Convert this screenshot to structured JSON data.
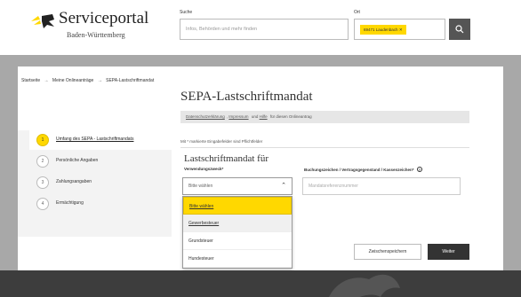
{
  "header": {
    "logo_title": "Serviceportal",
    "logo_sub": "Baden-Württemberg",
    "search_label": "Suche",
    "search_placeholder": "Infos, Behörden und mehr finden",
    "ort_label": "Ort",
    "ort_value": "69471 Laudenbach",
    "search_button_icon": "search-icon"
  },
  "breadcrumb": [
    "Startseite",
    "→",
    "Meine Onlineanträge",
    "→",
    "SEPA-Lastschriftmandat"
  ],
  "page_title": "SEPA-Lastschriftmandat",
  "infobar": {
    "link1": "Datenschutzerklärung",
    "link2": "Impressum",
    "text1": "und",
    "link3": "Hilfe",
    "text2": "für diesen Onlineantrag"
  },
  "steps": [
    {
      "number": "1",
      "label": "Umfang des SEPA - Lastschriftmandats",
      "active": true
    },
    {
      "number": "2",
      "label": "Persönliche Angaben",
      "active": false
    },
    {
      "number": "3",
      "label": "Zahlungsangaben",
      "active": false
    },
    {
      "number": "4",
      "label": "Ermächtigung",
      "active": false
    }
  ],
  "form": {
    "pflicht_note": "Mit * markierte Eingabefelder sind Pflichtfelder",
    "section_title": "Lastschriftmandat für",
    "field1_label": "Verwendungszweck*",
    "field1_value": "Bitte wählen",
    "field2_label": "Buchungszeichen / Vertragsgegenstand / Kassenzeichen*",
    "field2_placeholder": "Mandatsreferenznummer"
  },
  "dropdown_options": [
    "Bitte wählen",
    "Gewerbesteuer",
    "Grundsteuer",
    "Hundesteuer"
  ],
  "buttons": {
    "zwischenspeichern": "Zwischenspeichern",
    "weiter": "Weiter"
  },
  "colors": {
    "accent": "#ffd800",
    "dark": "#333333",
    "footer": "#3d3d3d"
  }
}
